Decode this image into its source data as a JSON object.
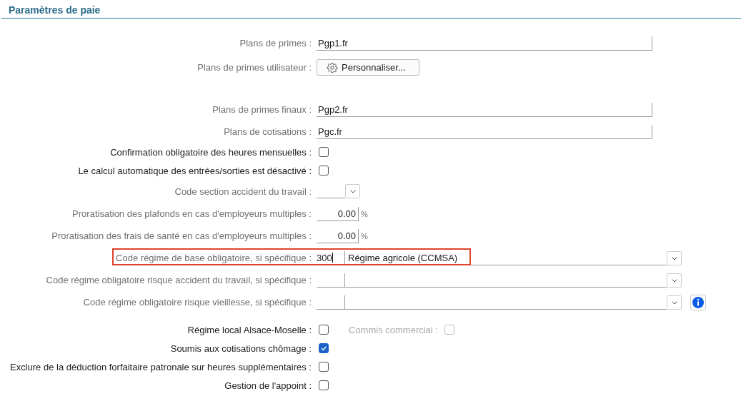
{
  "section_title": "Paramètres de paie",
  "groups": [
    {
      "rows": [
        {
          "kind": "text",
          "label": "Plans de primes :",
          "value": "Pgp1.fr"
        },
        {
          "kind": "button",
          "label": "Plans de primes utilisateur :",
          "button": "Personnaliser..."
        }
      ]
    },
    {
      "rows": [
        {
          "kind": "text",
          "label": "Plans de primes finaux :",
          "value": "Pgp2.fr"
        },
        {
          "kind": "text",
          "label": "Plans de cotisations :",
          "value": "Pgc.fr"
        },
        {
          "kind": "checkbox",
          "label": "Confirmation obligatoire des heures mensuelles :",
          "checked": false
        },
        {
          "kind": "checkbox",
          "label": "Le calcul automatique des entrées/sorties est désactivé :",
          "checked": false
        },
        {
          "kind": "combo",
          "label": "Code section accident du travail :"
        },
        {
          "kind": "percent",
          "label": "Proratisation des plafonds en cas d'employeurs multiples :",
          "value": "0.00",
          "unit": "%"
        },
        {
          "kind": "percent",
          "label": "Proratisation des frais de santé en cas d'employeurs multiples :",
          "value": "0.00",
          "unit": "%"
        },
        {
          "kind": "code",
          "label": "Code régime de base obligatoire, si spécifique :",
          "code": "300",
          "description": "Régime agricole (CCMSA)",
          "highlighted": true,
          "focused": true,
          "info": false
        },
        {
          "kind": "code",
          "label": "Code régime obligatoire risque accident du travail, si spécifique :",
          "highlighted": false,
          "focused": false,
          "info": false
        },
        {
          "kind": "code",
          "label": "Code régime obligatoire risque vieillesse, si spécifique :",
          "highlighted": false,
          "focused": false,
          "info": true
        }
      ]
    },
    {
      "rows": [
        {
          "kind": "checkbox",
          "label": "Régime local Alsace-Moselle :",
          "checked": false,
          "extra": {
            "label": "Commis commercial :",
            "checked": false,
            "disabled": true
          }
        },
        {
          "kind": "checkbox",
          "label": "Soumis aux cotisations chômage :",
          "checked": true
        },
        {
          "kind": "checkbox",
          "label": "Exclure de la déduction forfaitaire patronale sur heures supplémentaires :",
          "checked": false
        },
        {
          "kind": "checkbox",
          "label": "Gestion de l'appoint :",
          "checked": false
        }
      ]
    }
  ]
}
